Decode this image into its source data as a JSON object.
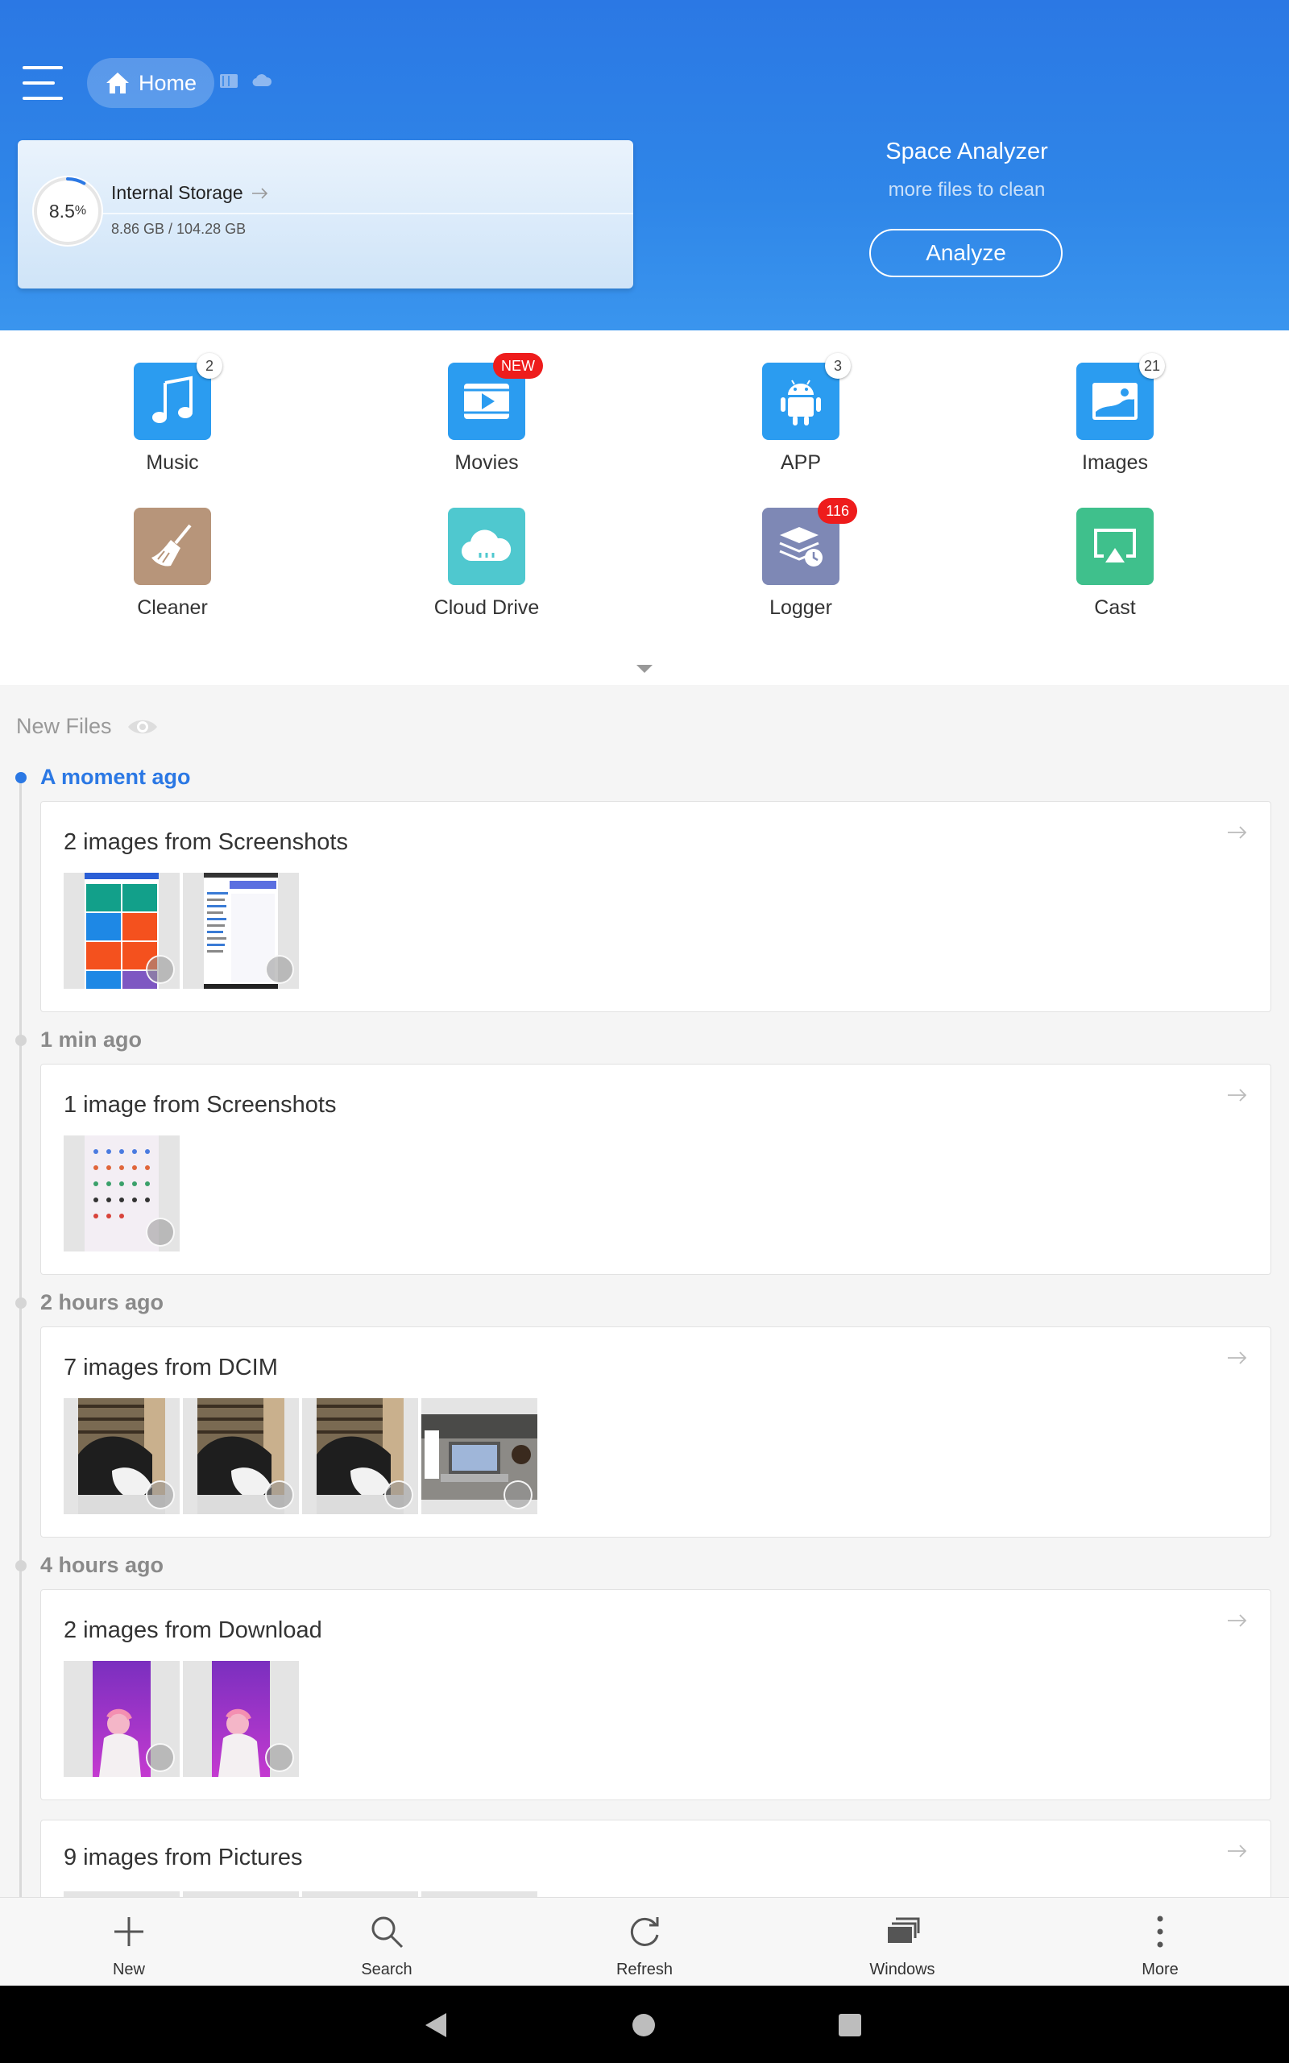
{
  "header": {
    "breadcrumb_home": "Home",
    "storage": {
      "percent_label": "8.5",
      "percent_unit": "%",
      "percent": 8.5,
      "title": "Internal Storage",
      "size": "8.86 GB / 104.28 GB"
    },
    "space_analyzer": {
      "title": "Space Analyzer",
      "subtitle": "more files to clean",
      "button": "Analyze"
    }
  },
  "categories": [
    {
      "label": "Music",
      "badge": "2",
      "color": "#2b9cf0",
      "icon": "music-icon"
    },
    {
      "label": "Movies",
      "badge": "NEW",
      "color": "#2b9cf0",
      "icon": "movie-icon"
    },
    {
      "label": "APP",
      "badge": "3",
      "color": "#2b9cf0",
      "icon": "android-icon"
    },
    {
      "label": "Images",
      "badge": "21",
      "color": "#2b9cf0",
      "icon": "image-icon"
    },
    {
      "label": "Cleaner",
      "badge": "",
      "color": "#b7957a",
      "icon": "broom-icon"
    },
    {
      "label": "Cloud Drive",
      "badge": "",
      "color": "#4fc8cf",
      "icon": "cloud-icon"
    },
    {
      "label": "Logger",
      "badge": "116",
      "color": "#7e88b5",
      "icon": "logger-icon"
    },
    {
      "label": "Cast",
      "badge": "",
      "color": "#3fc08c",
      "icon": "cast-icon"
    }
  ],
  "new_files": {
    "heading": "New Files",
    "groups": [
      {
        "time": "A moment ago",
        "title": "2 images from Screenshots"
      },
      {
        "time": "1 min ago",
        "title": "1 image from Screenshots"
      },
      {
        "time": "2 hours ago",
        "title": "7 images from DCIM"
      },
      {
        "time": "4 hours ago",
        "title": "2 images from Download"
      },
      {
        "time": "",
        "title": "9 images from Pictures"
      }
    ]
  },
  "bottom_bar": [
    {
      "label": "New",
      "icon": "plus-icon"
    },
    {
      "label": "Search",
      "icon": "search-icon"
    },
    {
      "label": "Refresh",
      "icon": "refresh-icon"
    },
    {
      "label": "Windows",
      "icon": "windows-icon"
    },
    {
      "label": "More",
      "icon": "more-vertical-icon"
    }
  ],
  "colors": {
    "accent": "#2b78e4",
    "badge_red": "#ee1c1c"
  }
}
